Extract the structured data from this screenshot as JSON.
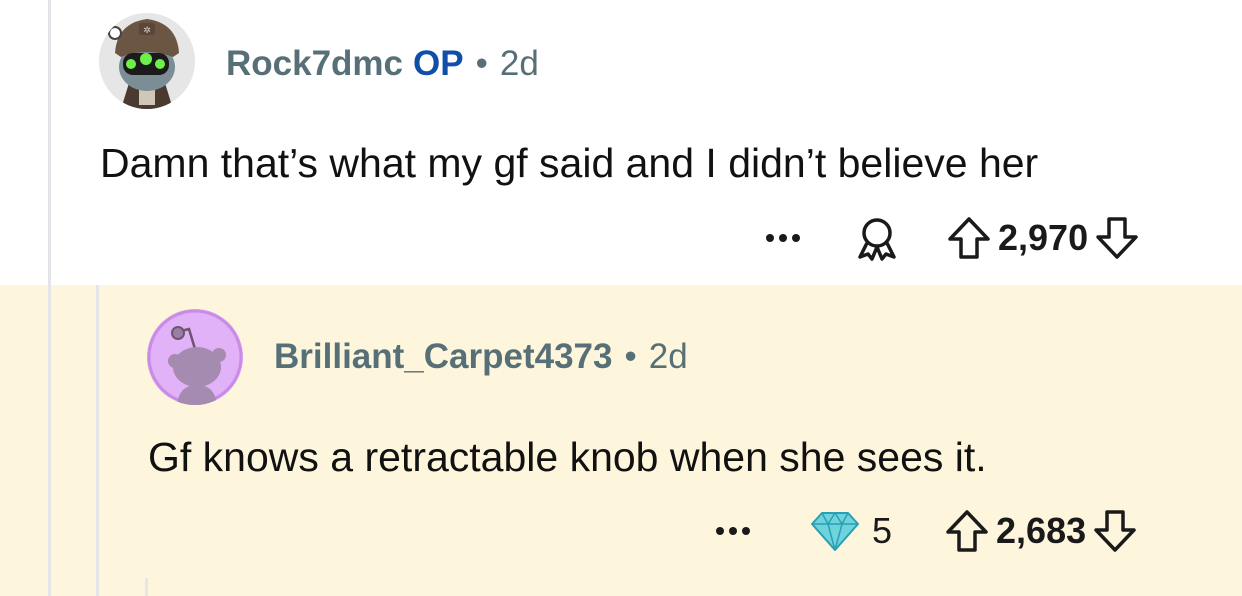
{
  "comments": [
    {
      "author": "Rock7dmc",
      "op_badge": "OP",
      "separator": "•",
      "age": "2d",
      "text": "Damn that’s what my gf said and I didn’t believe her",
      "score": "2,970",
      "actions": {
        "more_icon": "more-icon",
        "award_icon": "award-icon",
        "upvote_icon": "arrow-up-icon",
        "downvote_icon": "arrow-down-icon"
      }
    },
    {
      "author": "Brilliant_Carpet4373",
      "separator": "•",
      "age": "2d",
      "text": "Gf knows a retractable knob when she sees it.",
      "award_count": "5",
      "score": "2,683",
      "highlight_color": "#fdf6dd",
      "actions": {
        "more_icon": "more-icon",
        "award_icon": "diamond-icon",
        "upvote_icon": "arrow-up-icon",
        "downvote_icon": "arrow-down-icon"
      }
    }
  ]
}
